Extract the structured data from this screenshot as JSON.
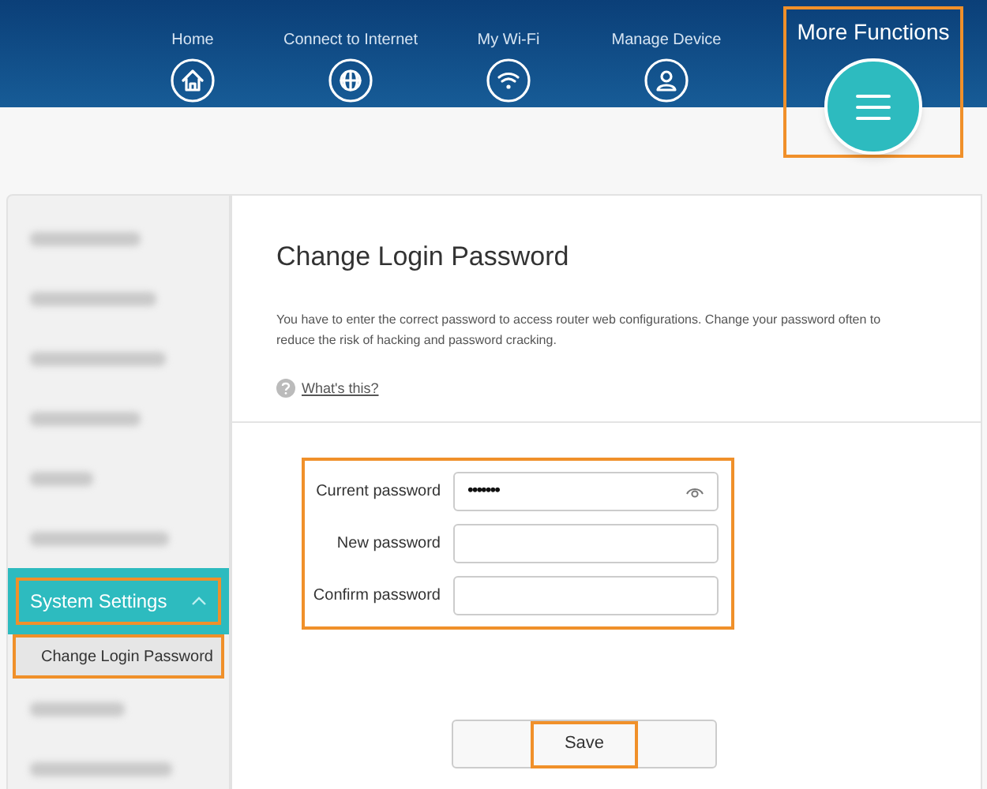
{
  "nav": [
    {
      "label": "Home",
      "kind": "home",
      "selected": false,
      "highlighted": false
    },
    {
      "label": "Connect to Internet",
      "kind": "globe",
      "selected": false,
      "highlighted": false
    },
    {
      "label": "My Wi-Fi",
      "kind": "wifi",
      "selected": false,
      "highlighted": false
    },
    {
      "label": "Manage Device",
      "kind": "user",
      "selected": false,
      "highlighted": false
    },
    {
      "label": "More Functions",
      "kind": "menu",
      "selected": true,
      "highlighted": true
    }
  ],
  "sidebar": {
    "items": [
      {
        "kind": "blurred"
      },
      {
        "kind": "blurred"
      },
      {
        "kind": "blurred"
      },
      {
        "kind": "blurred"
      },
      {
        "kind": "blurred"
      },
      {
        "kind": "blurred"
      },
      {
        "kind": "group",
        "label": "System Settings",
        "expanded": true,
        "selected": true,
        "highlighted": true,
        "children": [
          {
            "label": "Change Login Password",
            "selected": true,
            "highlighted": true
          }
        ]
      },
      {
        "kind": "blurred"
      },
      {
        "kind": "blurred"
      }
    ]
  },
  "content": {
    "title": "Change Login Password",
    "description": "You have to enter the correct password to access router web configurations. Change your password often to reduce the risk of hacking and password cracking.",
    "help_link": "What's this?",
    "form": {
      "highlighted": true,
      "fields": [
        {
          "label": "Current password",
          "value": "•••••••",
          "kind": "password"
        },
        {
          "label": "New password",
          "kind": "text"
        },
        {
          "label": "Confirm password",
          "kind": "text"
        }
      ]
    },
    "save_button": {
      "label": "Save",
      "highlighted": true
    }
  }
}
